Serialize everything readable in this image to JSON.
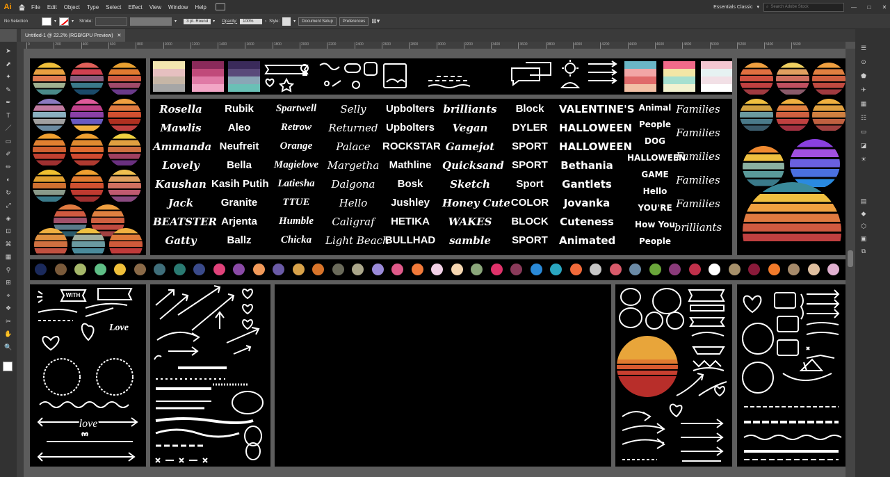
{
  "menubar": {
    "logo": "Ai",
    "items": [
      "File",
      "Edit",
      "Object",
      "Type",
      "Select",
      "Effect",
      "View",
      "Window",
      "Help"
    ],
    "workspace": "Essentials Classic",
    "search_placeholder": "Search Adobe Stock"
  },
  "control": {
    "selection": "No Selection",
    "stroke_label": "Stroke:",
    "brush": "3 pt. Round",
    "opacity_label": "Opacity:",
    "opacity_value": "100%",
    "style_label": "Style:",
    "doc_setup": "Document Setup",
    "preferences": "Preferences"
  },
  "document_tab": {
    "title": "Untitled-1 @ 22.2% (RGB/GPU Preview)"
  },
  "ruler": {
    "ticks": [
      "0",
      "200",
      "400",
      "600",
      "800",
      "1000",
      "1200",
      "1400",
      "1600",
      "1800",
      "2000",
      "2200",
      "2400",
      "2600",
      "2800",
      "3000",
      "3200",
      "3400",
      "3600",
      "3800",
      "4000",
      "4200",
      "4400",
      "4600",
      "4800",
      "5000",
      "5200",
      "5400",
      "5600"
    ]
  },
  "fonts": [
    [
      "Rosella",
      "Mawlis",
      "Ammanda",
      "Lovely",
      "Kaushan",
      "Jack",
      "BEATSTER",
      "Gatty"
    ],
    [
      "Rubik",
      "Aleo",
      "Neufreit",
      "Bella",
      "Kasih Putih",
      "Granite",
      "Arjenta",
      "Ballz"
    ],
    [
      "Spartwell",
      "Retrow",
      "Orange",
      "Magielove",
      "Latiesha",
      "TTUE",
      "Humble",
      "Chicka"
    ],
    [
      "Selly",
      "Returned",
      "Palace",
      "Margetha",
      "Dalgona",
      "Hello",
      "Caligraf",
      "Light Beach"
    ],
    [
      "Upbolters",
      "Upbolters",
      "ROCKSTAR",
      "Mathline",
      "Bosk",
      "Jushley",
      "HETIKA",
      "BULLHAD"
    ],
    [
      "brilliants",
      "Vegan",
      "Gamejot",
      "Quicksand",
      "Sketch",
      "Honey Cute",
      "WAKES",
      "samble"
    ],
    [
      "Block",
      "DYLER",
      "SPORT",
      "SPORT",
      "Sport",
      "COLOR",
      "BLOCK",
      "SPORT"
    ],
    [
      "VALENTINE'S",
      "HALLOWEEN",
      "HALLOWEEN",
      "Bethania",
      "Gantlets",
      "Jovanka",
      "Cuteness",
      "Animated"
    ],
    [
      "Animal",
      "People",
      "DOG",
      "HALLOWEEN",
      "GAME",
      "Hello",
      "YOU'RE",
      "How You",
      "People"
    ],
    [
      "Families",
      "Families",
      "Families",
      "Families",
      "Families",
      "brilliants"
    ]
  ],
  "doodle_labels": {
    "with": "WITH",
    "love": "Love",
    "love2": "love"
  },
  "palette": [
    "#1b2a5c",
    "#7a5a3a",
    "#a6b86a",
    "#5fbf86",
    "#f0c03a",
    "#8a6a48",
    "#3f6e7a",
    "#2a7a72",
    "#3a4a8a",
    "#e0427a",
    "#8a4aa6",
    "#f29a5a",
    "#6a5aa6",
    "#d8a24a",
    "#d8742a",
    "#6a6a5a",
    "#aaa68a",
    "#9a8ad8",
    "#e05a8a",
    "#f27a3a",
    "#f2d0e6",
    "#f6d6b0",
    "#8aa67a",
    "#e0326a",
    "#8a3a5a",
    "#2a8ad8",
    "#2aa6c0",
    "#f26a3a",
    "#c6c6c6",
    "#d85a6a",
    "#6a8aa6",
    "#6aa63a",
    "#8a3a7a",
    "#c0304a",
    "#ffffff",
    "#a6906a",
    "#8a1a3a",
    "#f27a2a",
    "#a68a6a",
    "#e0c0a0",
    "#e0b0d0"
  ],
  "swatches_top": [
    [
      "#f2e6b0",
      "#e6c0c0",
      "#c6b6a6",
      "#a6a6a6"
    ],
    [
      "#8a2a5a",
      "#c04a7a",
      "#e07aa6",
      "#f2a6c6"
    ],
    [
      "#3a2a5a",
      "#5a4a7a",
      "#8aa6b6",
      "#6ac0b6"
    ],
    [
      "#6ab6c6",
      "#f2a6a6",
      "#e06a6a",
      "#f2c0a6"
    ],
    [
      "#f26a8a",
      "#f2e6a6",
      "#a6e0d0",
      "#f2f2d0"
    ],
    [
      "#f2c6d0",
      "#e6f2f2",
      "#f2e0e6",
      "#ffffff"
    ]
  ]
}
